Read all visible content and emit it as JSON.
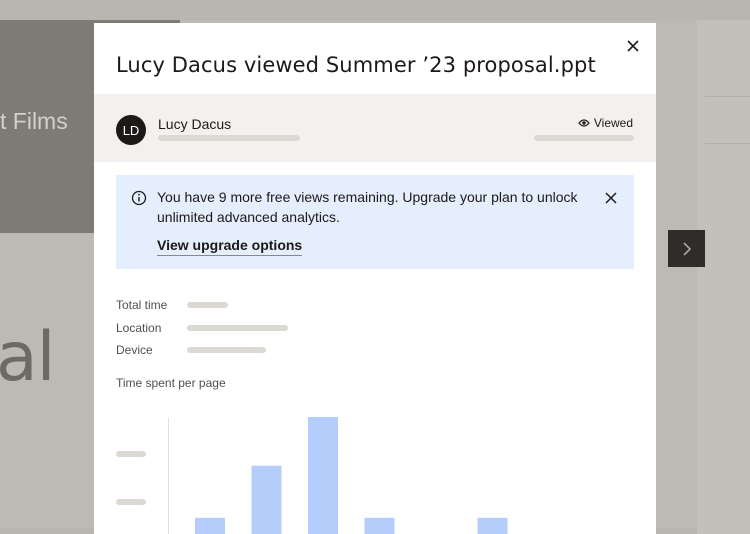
{
  "background": {
    "hero_text": "t Films",
    "big_text": "al"
  },
  "modal": {
    "title": "Lucy Dacus viewed Summer ’23 proposal.ppt",
    "viewer": {
      "initials": "LD",
      "name": "Lucy Dacus",
      "status": "Viewed"
    },
    "banner": {
      "message": "You have 9 more free views remaining. Upgrade your plan to unlock unlimited advanced analytics.",
      "link": "View upgrade options"
    },
    "stats": [
      {
        "label": "Total time"
      },
      {
        "label": "Location"
      },
      {
        "label": "Device"
      }
    ],
    "chart_title": "Time spent per page"
  },
  "colors": {
    "bar": "#b4cdfa",
    "banner_bg": "#e4eefc",
    "skeleton": "#dcd9d4"
  },
  "chart_data": {
    "type": "bar",
    "title": "Time spent per page",
    "xlabel": "",
    "ylabel": "",
    "values": [
      0.75,
      2.3,
      3.75,
      0.75,
      0,
      0.75
    ],
    "ylim": [
      0,
      3.75
    ]
  }
}
